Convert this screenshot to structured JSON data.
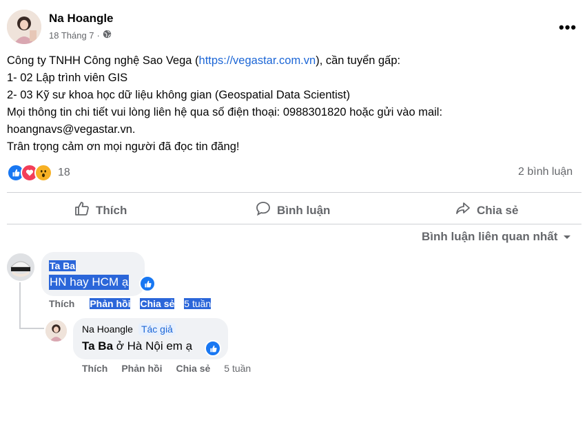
{
  "post": {
    "author": "Na Hoangle",
    "date": "18 Tháng 7",
    "lines": [
      {
        "pre": "Công ty TNHH Công nghệ Sao Vega (",
        "link": "https://vegastar.com.vn",
        "post": "), cần tuyển gấp:"
      },
      {
        "pre": "1- 02 Lập trình viên GIS"
      },
      {
        "pre": "2- 03 Kỹ sư khoa học dữ liệu không gian (Geospatial Data Scientist)"
      },
      {
        "pre": "Mọi thông tin chi tiết vui lòng liên hệ qua số điện thoại: 0988301820 hoặc gửi vào mail:"
      },
      {
        "pre": "hoangnavs@vegastar.vn."
      },
      {
        "pre": "Trân trọng cảm ơn mọi người đã đọc tin đăng!"
      }
    ],
    "reaction_count": "18",
    "comment_count": "2 bình luận"
  },
  "actions": {
    "like": "Thích",
    "comment": "Bình luận",
    "share": "Chia sẻ"
  },
  "sort_label": "Bình luận liên quan nhất",
  "comments": [
    {
      "author": "Ta Ba",
      "text": "HN hay HCM ạ",
      "like": "Thích",
      "reply": "Phản hồi",
      "share": "Chia sẻ",
      "time": "5 tuần"
    }
  ],
  "reply": {
    "author": "Na Hoangle",
    "tag": "Tác giả",
    "mention": "Ta Ba",
    "text": " ở Hà Nội em ạ",
    "like": "Thích",
    "reply": "Phản hồi",
    "share": "Chia sẻ",
    "time": "5 tuần"
  },
  "colors": {
    "accent": "#1877f2",
    "selection": "#2b66d9",
    "link": "#1c66d6"
  }
}
